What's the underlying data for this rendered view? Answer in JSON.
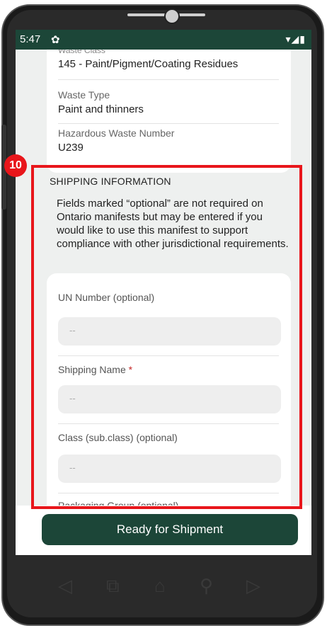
{
  "status_bar": {
    "time": "5:47",
    "gear_glyph": "✿",
    "icons_glyph": "▾◢▮"
  },
  "waste_card": {
    "partial_label": "Waste Class",
    "waste_class_value": "145 - Paint/Pigment/Coating Residues",
    "waste_type_label": "Waste Type",
    "waste_type_value": "Paint and thinners",
    "hazardous_label": "Hazardous Waste Number",
    "hazardous_value": "U239"
  },
  "shipping": {
    "heading": "SHIPPING INFORMATION",
    "note": "Fields marked “optional” are not required on Ontario manifests but may be entered if you would like to use this manifest to support compliance with other jurisdictional requirements.",
    "fields": [
      {
        "label": "UN Number (optional)",
        "placeholder": "--"
      },
      {
        "label": "Shipping Name",
        "required_mark": "*",
        "placeholder": "--"
      },
      {
        "label": "Class (sub.class) (optional)",
        "placeholder": "--"
      },
      {
        "label": "Packaging Group (optional)"
      }
    ]
  },
  "ready_button": "Ready for Shipment",
  "step_badge": "10",
  "nav_icons": [
    "back-triangle-icon",
    "recent-apps-icon",
    "home-icon",
    "search-icon",
    "forward-triangle-icon"
  ],
  "colors": {
    "primary": "#1c4638",
    "highlight": "#e8161b",
    "background": "#eef0ef"
  }
}
